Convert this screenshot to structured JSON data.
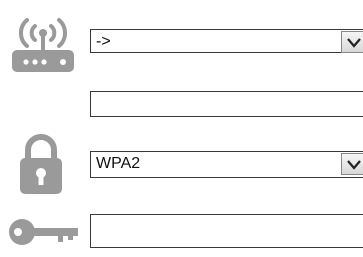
{
  "network": {
    "selected_value": "->",
    "name_value": ""
  },
  "security": {
    "selected_value": "WPA2"
  },
  "key": {
    "value": ""
  },
  "icons": {
    "router": "router-icon",
    "lock": "lock-icon",
    "key": "key-icon",
    "dropdown": "chevron-down-icon"
  },
  "colors": {
    "icon_gray": "#9a9a9a",
    "border": "#3a3a3a"
  }
}
